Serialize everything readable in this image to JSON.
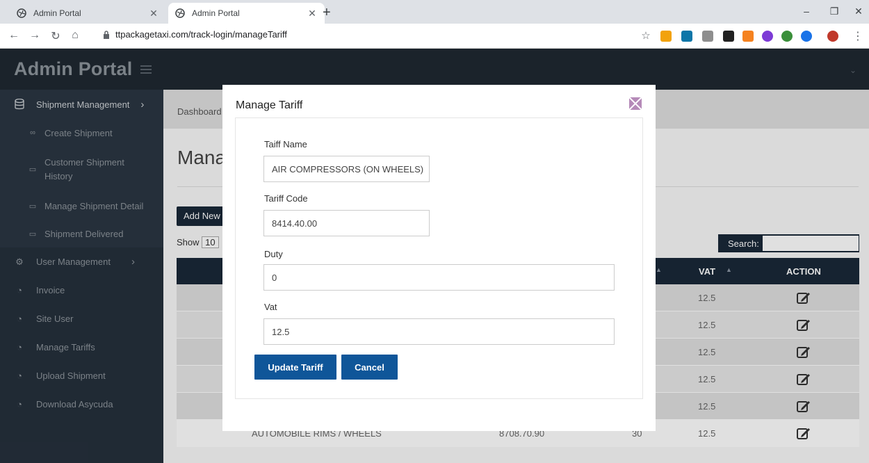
{
  "browser": {
    "tabs": [
      {
        "title": "Admin Portal",
        "active": false
      },
      {
        "title": "Admin Portal",
        "active": true
      }
    ],
    "url": "ttpackagetaxi.com/track-login/manageTariff"
  },
  "app": {
    "brand": "Admin Portal",
    "menu": {
      "shipment_management": "Shipment Management",
      "create_shipment": "Create Shipment",
      "customer_shipment_history": "Customer Shipment History",
      "manage_shipment_detail": "Manage Shipment Detail",
      "shipment_delivered": "Shipment Delivered",
      "user_management": "User Management",
      "invoice": "Invoice",
      "site_user": "Site User",
      "manage_tariffs": "Manage Tariffs",
      "upload_shipment": "Upload Shipment",
      "download_asycuda": "Download Asycuda"
    },
    "breadcrumb": "Dashboard",
    "page_title": "Mana",
    "add_new_label": "Add New",
    "show_label": "Show",
    "show_value": "10",
    "search_label": "Search:",
    "table": {
      "headers": {
        "vat": "VAT",
        "action": "ACTION"
      },
      "rows": [
        {
          "name": "",
          "code": "",
          "duty": "",
          "vat": "12.5"
        },
        {
          "name": "",
          "code": "",
          "duty": "",
          "vat": "12.5"
        },
        {
          "name": "",
          "code": "",
          "duty": "",
          "vat": "12.5"
        },
        {
          "name": "",
          "code": "",
          "duty": "",
          "vat": "12.5"
        },
        {
          "name": "",
          "code": "",
          "duty": "",
          "vat": "12.5"
        },
        {
          "name": "AUTOMOBILE RIMS / WHEELS",
          "code": "8708.70.90",
          "duty": "30",
          "vat": "12.5"
        }
      ]
    }
  },
  "modal": {
    "title": "Manage Tariff",
    "fields": {
      "name_label": "Taiff Name",
      "name_value": "AIR COMPRESSORS (ON WHEELS)",
      "code_label": "Tariff Code",
      "code_value": "8414.40.00",
      "duty_label": "Duty",
      "duty_value": "0",
      "vat_label": "Vat",
      "vat_value": "12.5"
    },
    "update_label": "Update Tariff",
    "cancel_label": "Cancel"
  },
  "colors": {
    "sidebar": "#25303c",
    "header_dark": "#1a2838",
    "primary_button": "#0f5699"
  }
}
